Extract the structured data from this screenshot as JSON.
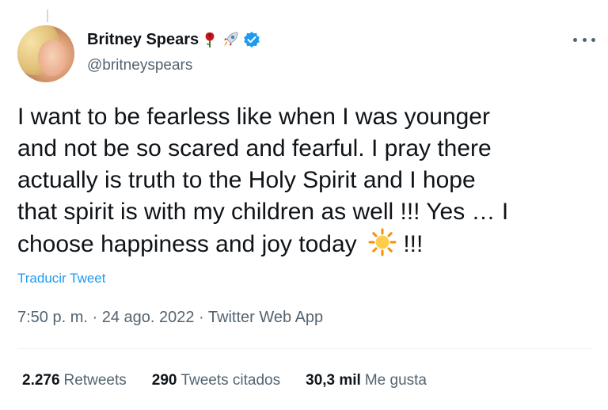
{
  "author": {
    "name": "Britney Spears",
    "handle": "@britneyspears",
    "name_emojis": [
      "rose-icon",
      "rocket-icon"
    ],
    "verified": true
  },
  "tweet": {
    "text_lines": [
      "I want to be fearless like when I was younger",
      "and not be so scared and fearful. I pray there",
      "actually is truth to the Holy Spirit and I hope",
      "that spirit is with my children as well !!! Yes … I",
      "choose happiness and joy today"
    ],
    "text_tail": " !!!",
    "inline_emoji": "sun-icon",
    "translate_label": "Traducir Tweet",
    "meta": "7:50 p. m. · 24 ago. 2022 · Twitter Web App"
  },
  "stats": {
    "retweets_count": "2.276",
    "retweets_label": "Retweets",
    "quotes_count": "290",
    "quotes_label": "Tweets citados",
    "likes_count": "30,3 mil",
    "likes_label": "Me gusta"
  },
  "colors": {
    "accent": "#1d9bf0",
    "text_primary": "#0f1419",
    "text_secondary": "#536471"
  }
}
